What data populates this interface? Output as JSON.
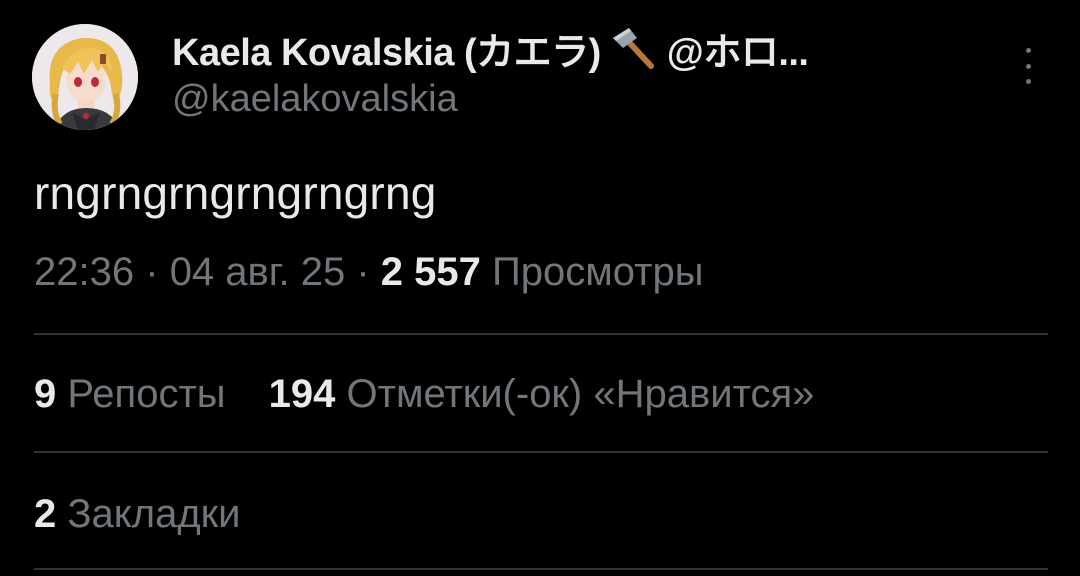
{
  "author": {
    "display_name": "Kaela Kovalskia (カエラ)",
    "affiliation_truncated": "@ホロ...",
    "handle": "@kaelakovalskia",
    "name_emoji": "hammer-icon"
  },
  "tweet": {
    "text": "rngrngrngrngrngrng",
    "time": "22:36",
    "date": "04 авг. 25",
    "separator": "·",
    "views_count": "2 557",
    "views_label": "Просмотры"
  },
  "stats": {
    "reposts_count": "9",
    "reposts_label": "Репосты",
    "likes_count": "194",
    "likes_label": "Отметки(-ок) «Нравится»",
    "bookmarks_count": "2",
    "bookmarks_label": "Закладки"
  },
  "colors": {
    "background": "#000000",
    "primary_text": "#e7e9ea",
    "secondary_text": "#71767b",
    "divider": "#2f3336"
  }
}
